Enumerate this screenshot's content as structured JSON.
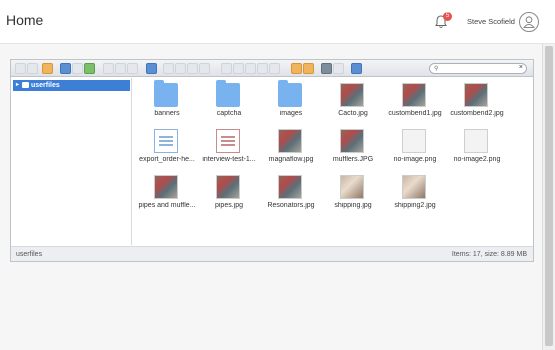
{
  "header": {
    "title": "Home",
    "notification_count": "5",
    "user_name": "Steve Scofield"
  },
  "toolbar": {
    "icons": [
      "back-icon",
      "forward-icon",
      "up-icon",
      "home-icon",
      "reload-icon",
      "save-icon",
      "select-icon",
      "open-icon",
      "copy-icon",
      "info-icon",
      "view-icon",
      "cut-icon",
      "paste-icon",
      "delete-icon",
      "rename-icon",
      "mkdir-icon",
      "mkfile-icon",
      "upload-icon",
      "download-icon",
      "archive-icon",
      "extract-icon",
      "icons-view-icon",
      "list-view-icon",
      "help-icon"
    ],
    "search_placeholder": ""
  },
  "tree": {
    "items": [
      {
        "label": "userfiles"
      }
    ]
  },
  "files": [
    {
      "name": "banners",
      "type": "folder"
    },
    {
      "name": "captcha",
      "type": "folder"
    },
    {
      "name": "images",
      "type": "folder"
    },
    {
      "name": "Cacto.jpg",
      "type": "photo"
    },
    {
      "name": "custombend1.jpg",
      "type": "photo"
    },
    {
      "name": "custombend2.jpg",
      "type": "photo"
    },
    {
      "name": "export_order-he...",
      "type": "doc"
    },
    {
      "name": "interview-test-1...",
      "type": "doc-pdf"
    },
    {
      "name": "magnaflow.jpg",
      "type": "photo"
    },
    {
      "name": "mufflers.JPG",
      "type": "photo"
    },
    {
      "name": "no-image.png",
      "type": "noimg"
    },
    {
      "name": "no-image2.png",
      "type": "noimg"
    },
    {
      "name": "pipes and muffle...",
      "type": "photo"
    },
    {
      "name": "pipes.jpg",
      "type": "photo"
    },
    {
      "name": "Resonators.jpg",
      "type": "photo"
    },
    {
      "name": "shipping.jpg",
      "type": "photo2"
    },
    {
      "name": "shipping2.jpg",
      "type": "photo2"
    }
  ],
  "statusbar": {
    "path": "userfiles",
    "summary": "Items: 17, size: 8.89 MB"
  },
  "colors": {
    "accent": "#3d7fd6",
    "badge": "#e5534b",
    "folder": "#79b3ef"
  }
}
